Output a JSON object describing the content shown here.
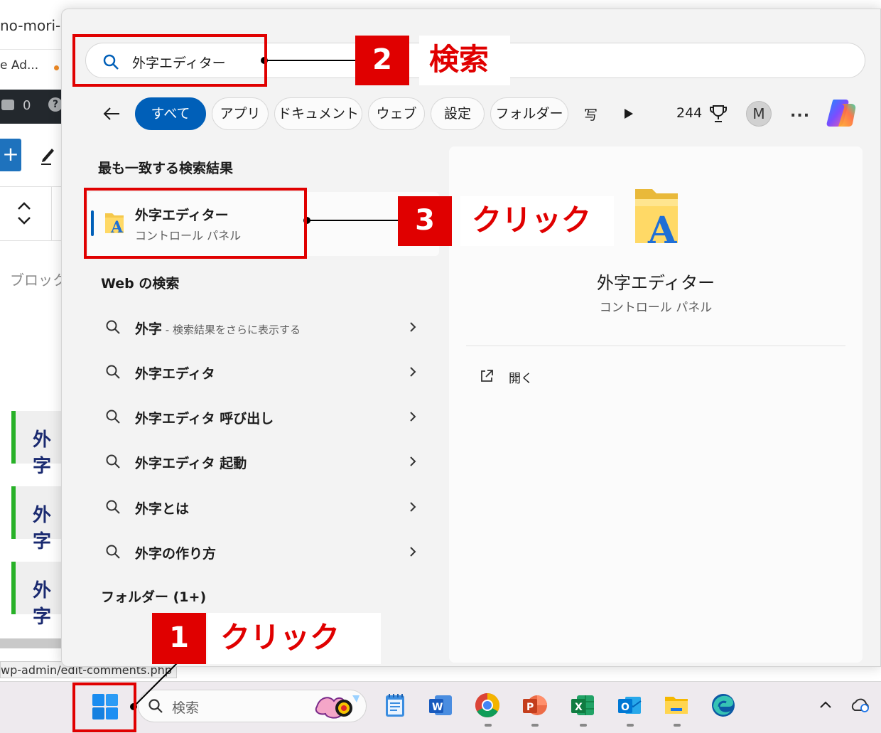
{
  "background": {
    "tab_title": "no-mori-b",
    "bookmark": "e Ad...",
    "admin_comment_count": "0",
    "admin_help": "?",
    "add_block_label": "+",
    "chevrons": "^",
    "block_placeholder": "ブロック",
    "headings": [
      "外字",
      "外字",
      "外字"
    ],
    "status_url": "wp-admin/edit-comments.php"
  },
  "search": {
    "query": "外字エディター"
  },
  "filters": {
    "chips": [
      "すべて",
      "アプリ",
      "ドキュメント",
      "ウェブ",
      "設定",
      "フォルダー",
      "写"
    ],
    "points": "244",
    "avatar_letter": "M",
    "more": "..."
  },
  "best_match": {
    "section_title": "最も一致する検索結果",
    "name": "外字エディター",
    "subtitle": "コントロール パネル"
  },
  "web": {
    "section_title": "Web の検索",
    "results": [
      {
        "main": "外字",
        "hint": " - 検索結果をさらに表示する"
      },
      {
        "main": "外字エディタ",
        "hint": ""
      },
      {
        "main": "外字エディタ 呼び出し",
        "hint": ""
      },
      {
        "main": "外字エディタ 起動",
        "hint": ""
      },
      {
        "main": "外字とは",
        "hint": ""
      },
      {
        "main": "外字の作り方",
        "hint": ""
      }
    ]
  },
  "folders": {
    "section_title": "フォルダー (1+)"
  },
  "preview": {
    "name": "外字エディター",
    "subtitle": "コントロール パネル",
    "open_label": "開く"
  },
  "taskbar": {
    "search_placeholder": "検索",
    "apps": [
      "notepad",
      "word",
      "chrome",
      "powerpoint",
      "excel",
      "outlook",
      "file-explorer",
      "edge"
    ]
  },
  "annotations": [
    {
      "number": "1",
      "label": "クリック"
    },
    {
      "number": "2",
      "label": "検索"
    },
    {
      "number": "3",
      "label": "クリック"
    }
  ],
  "colors": {
    "accent": "#005fb8",
    "annotation_red": "#e00000",
    "panel_bg": "#f3f3f3",
    "heading_bar": "#28b128"
  }
}
